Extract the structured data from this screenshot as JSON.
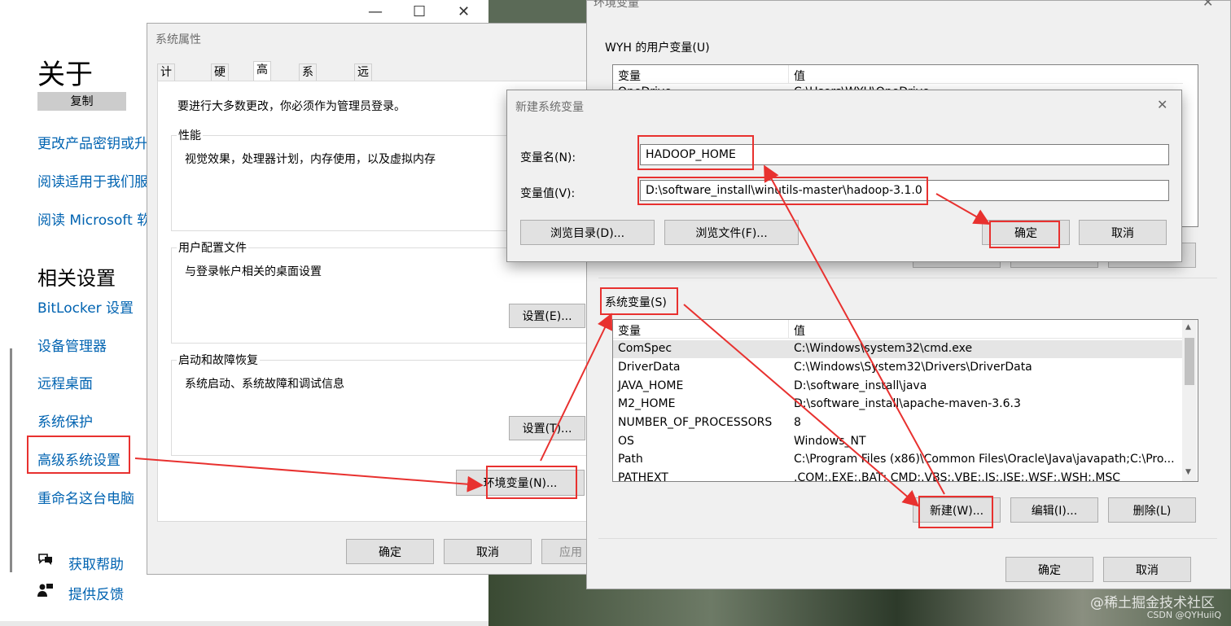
{
  "settings_window": {
    "window_controls": [
      "—",
      "☐",
      "✕"
    ],
    "title": "关于",
    "copy_button": "复制",
    "links": [
      "更改产品密钥或升",
      "阅读适用于我们服",
      "阅读 Microsoft 软"
    ],
    "related_heading": "相关设置",
    "related_links": [
      "BitLocker 设置",
      "设备管理器",
      "远程桌面",
      "系统保护",
      "高级系统设置",
      "重命名这台电脑"
    ],
    "help_links": [
      "获取帮助",
      "提供反馈"
    ]
  },
  "system_properties": {
    "title": "系统属性",
    "tabs": [
      "计算机名",
      "硬件",
      "高级",
      "系统保护",
      "远程"
    ],
    "active_tab": "高级",
    "admin_note": "要进行大多数更改，你必须作为管理员登录。",
    "performance": {
      "label": "性能",
      "desc": "视觉效果，处理器计划，内存使用，以及虚拟内存"
    },
    "user_profile": {
      "label": "用户配置文件",
      "desc": "与登录帐户相关的桌面设置",
      "button": "设置(E)..."
    },
    "startup": {
      "label": "启动和故障恢复",
      "desc": "系统启动、系统故障和调试信息",
      "button": "设置(T)..."
    },
    "env_button": "环境变量(N)...",
    "ok": "确定",
    "cancel": "取消",
    "apply": "应用"
  },
  "env_vars": {
    "title": "环境变量",
    "user_section": "WYH 的用户变量(U)",
    "col_var": "变量",
    "col_val": "值",
    "user_rows": [
      {
        "name": "OneDrive",
        "value": "C:\\Users\\WYH\\OneDrive"
      }
    ],
    "system_section": "系统变量(S)",
    "system_rows": [
      {
        "name": "ComSpec",
        "value": "C:\\Windows\\system32\\cmd.exe"
      },
      {
        "name": "DriverData",
        "value": "C:\\Windows\\System32\\Drivers\\DriverData"
      },
      {
        "name": "JAVA_HOME",
        "value": "D:\\software_install\\java"
      },
      {
        "name": "M2_HOME",
        "value": "D:\\software_install\\apache-maven-3.6.3"
      },
      {
        "name": "NUMBER_OF_PROCESSORS",
        "value": "8"
      },
      {
        "name": "OS",
        "value": "Windows_NT"
      },
      {
        "name": "Path",
        "value": "C:\\Program Files (x86)\\Common Files\\Oracle\\Java\\javapath;C:\\Pro..."
      },
      {
        "name": "PATHEXT",
        "value": ".COM;.EXE;.BAT;.CMD;.VBS;.VBE;.JS;.JSE;.WSF;.WSH;.MSC"
      }
    ],
    "new_button": "新建(W)...",
    "edit_button": "编辑(I)...",
    "delete_button": "删除(L)",
    "ok": "确定",
    "cancel": "取消"
  },
  "new_var_dialog": {
    "title": "新建系统变量",
    "close": "✕",
    "name_label": "变量名(N):",
    "name_value": "HADOOP_HOME",
    "value_label": "变量值(V):",
    "value_value": "D:\\software_install\\winutils-master\\hadoop-3.1.0",
    "browse_dir": "浏览目录(D)...",
    "browse_file": "浏览文件(F)...",
    "ok": "确定",
    "cancel": "取消"
  },
  "watermark": {
    "main": "@稀土掘金技术社区",
    "small": "CSDN @QYHuiiQ"
  },
  "colors": {
    "annotation": "#e8312f",
    "link": "#0063b1",
    "dialog_bg": "#f0f0f0"
  }
}
